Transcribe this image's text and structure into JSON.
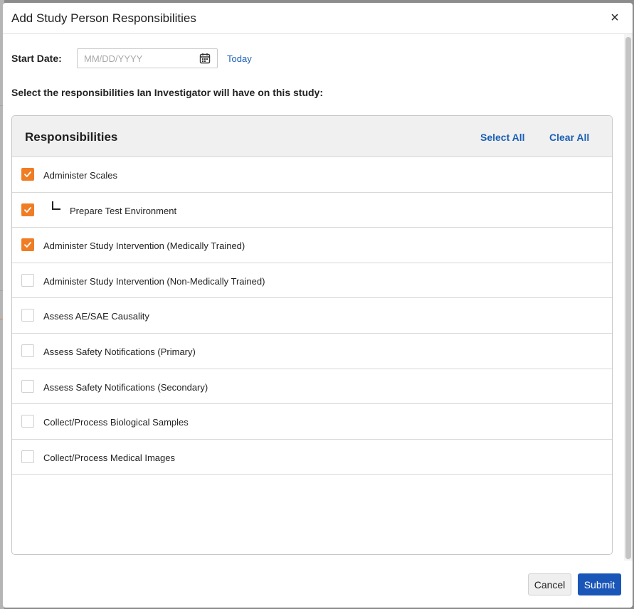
{
  "dialog": {
    "title": "Add Study Person Responsibilities",
    "close_icon": "close-icon"
  },
  "start_date": {
    "label": "Start Date:",
    "placeholder": "MM/DD/YYYY",
    "value": "",
    "calendar_icon": "calendar-icon",
    "today_label": "Today"
  },
  "instruction": "Select the responsibilities Ian Investigator will have on this study:",
  "responsibilities": {
    "title": "Responsibilities",
    "select_all": "Select All",
    "clear_all": "Clear All",
    "items": [
      {
        "label": "Administer Scales",
        "checked": true,
        "child": false
      },
      {
        "label": "Prepare Test Environment",
        "checked": true,
        "child": true
      },
      {
        "label": "Administer Study Intervention (Medically Trained)",
        "checked": true,
        "child": false
      },
      {
        "label": "Administer Study Intervention (Non-Medically Trained)",
        "checked": false,
        "child": false
      },
      {
        "label": "Assess AE/SAE Causality",
        "checked": false,
        "child": false
      },
      {
        "label": "Assess Safety Notifications (Primary)",
        "checked": false,
        "child": false
      },
      {
        "label": "Assess Safety Notifications (Secondary)",
        "checked": false,
        "child": false
      },
      {
        "label": "Collect/Process Biological Samples",
        "checked": false,
        "child": false
      },
      {
        "label": "Collect/Process Medical Images",
        "checked": false,
        "child": false
      }
    ]
  },
  "footer": {
    "cancel": "Cancel",
    "submit": "Submit"
  },
  "colors": {
    "accent": "#f07c24",
    "link": "#1a5fb4",
    "primary_button": "#1a56b8"
  }
}
